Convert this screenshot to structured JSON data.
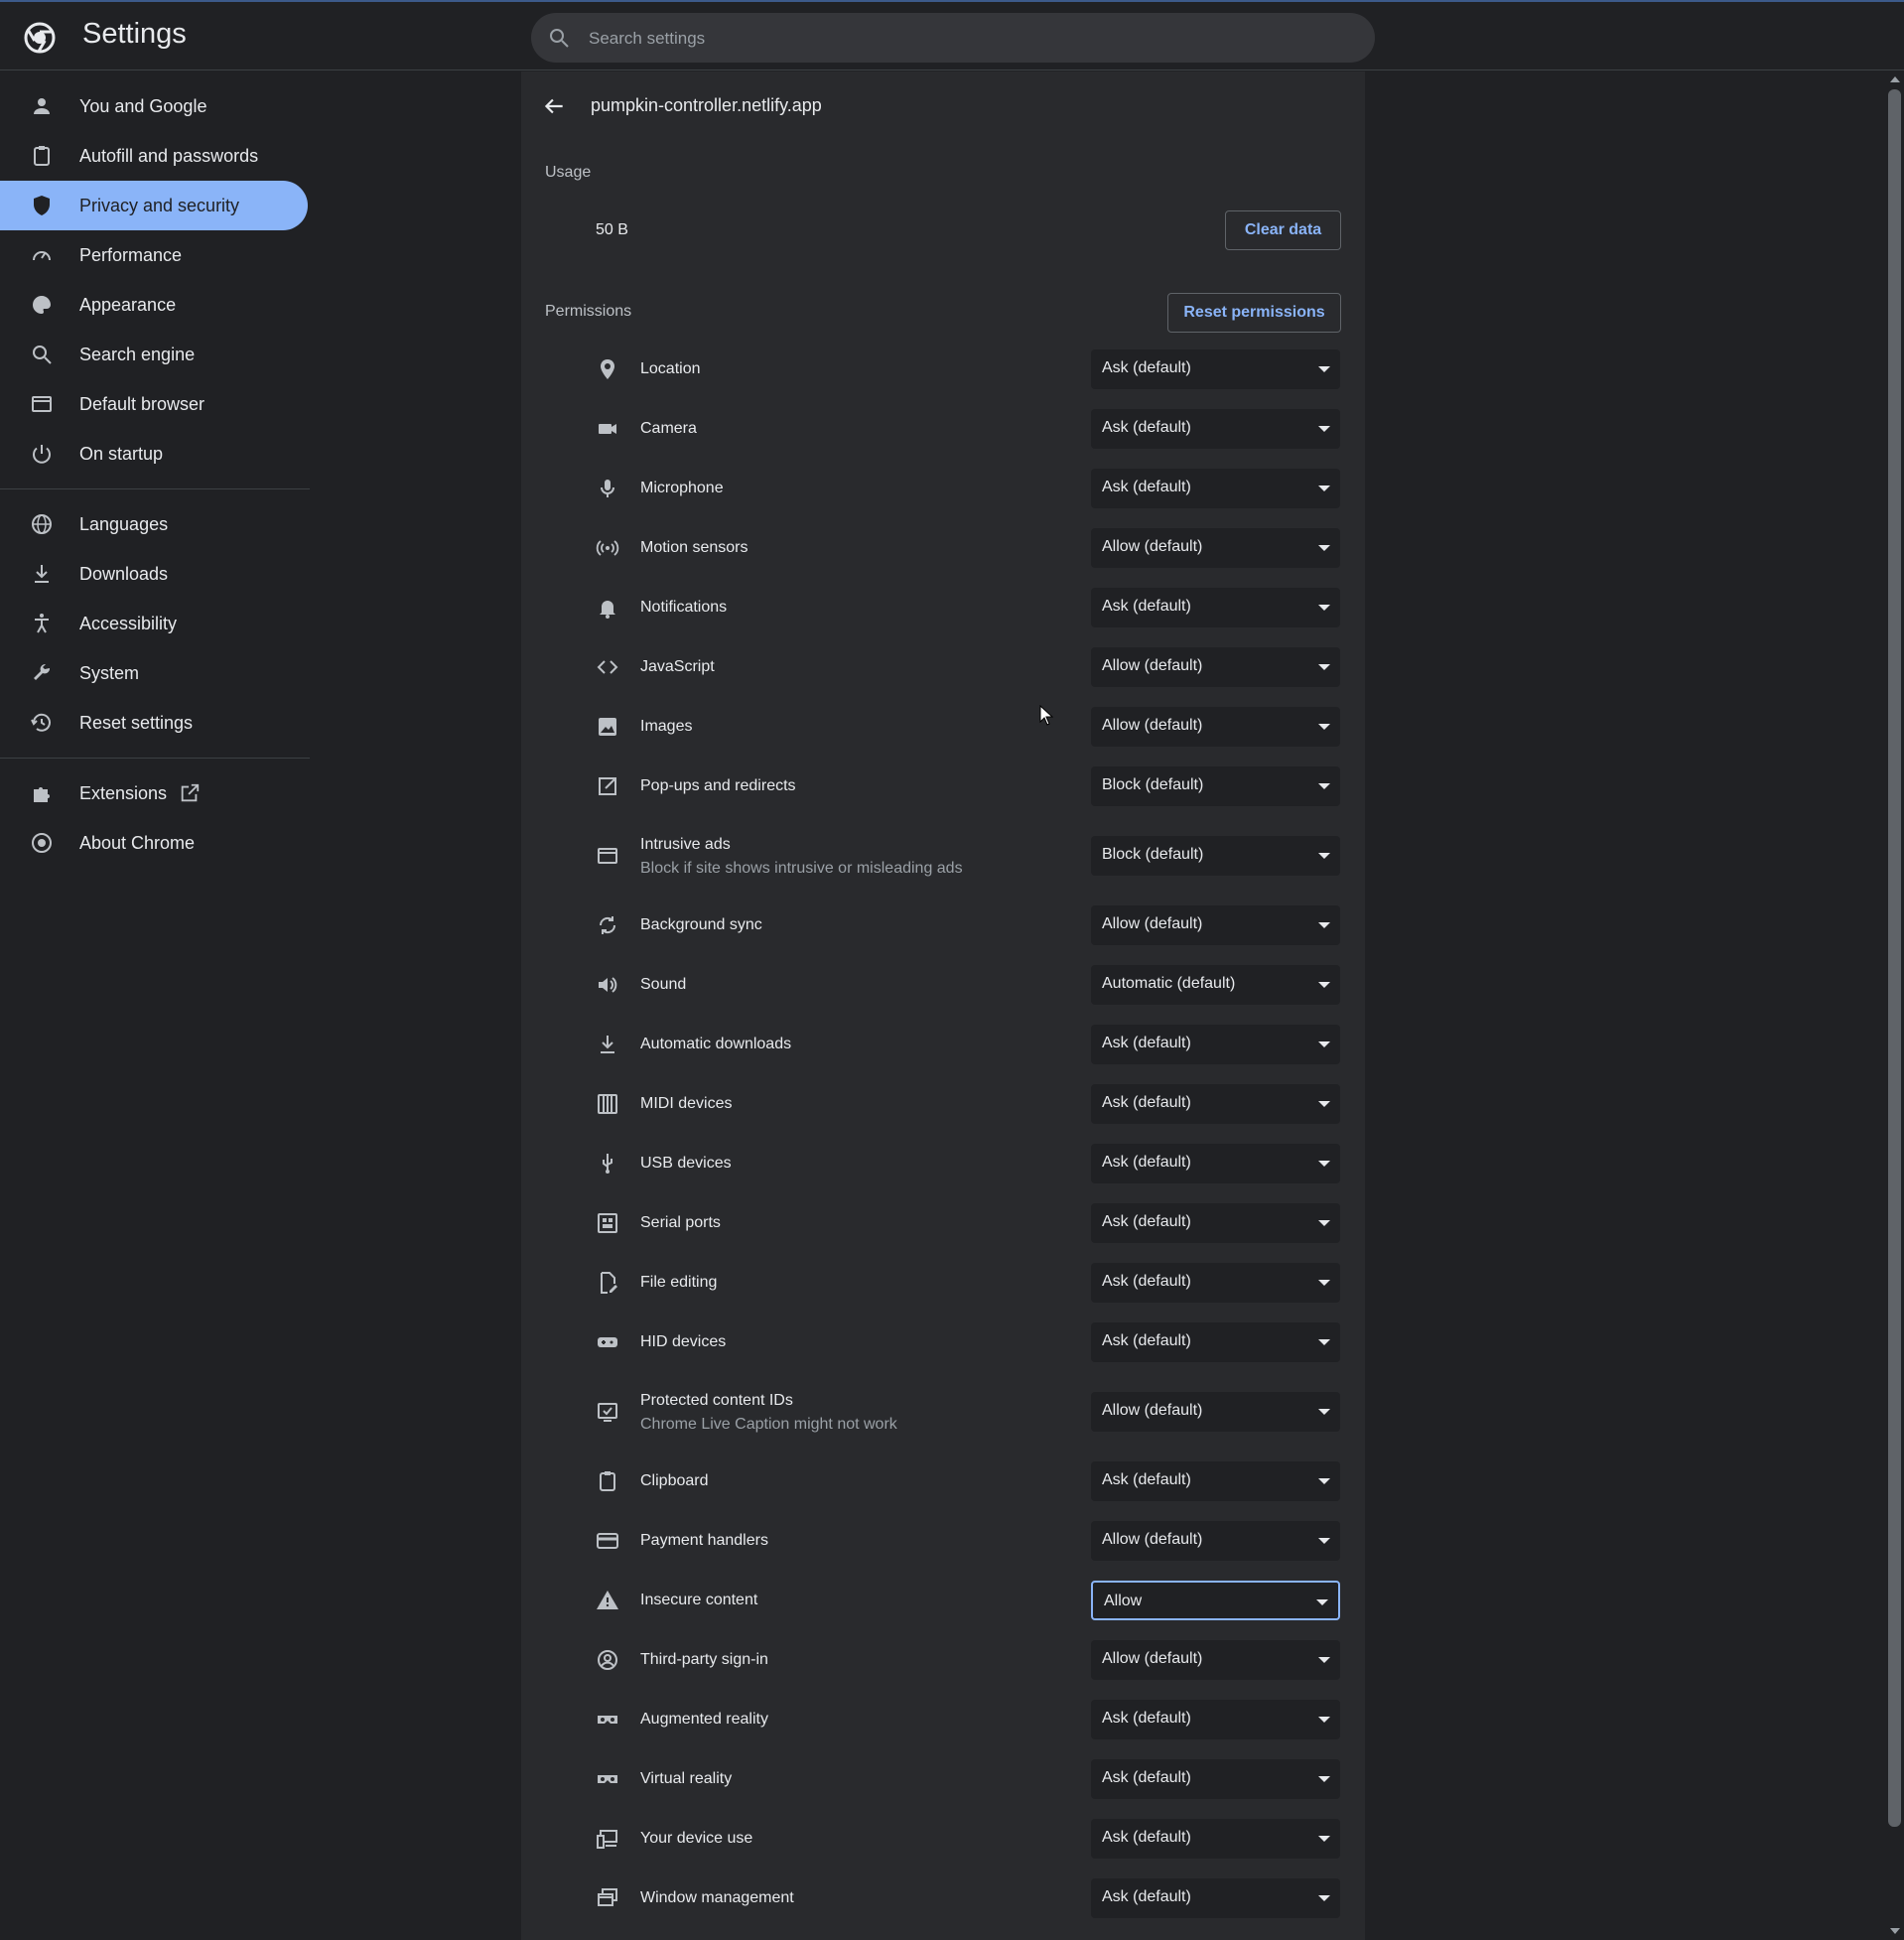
{
  "app": {
    "title": "Settings"
  },
  "search": {
    "placeholder": "Search settings"
  },
  "sidebar": {
    "groups": [
      [
        {
          "label": "You and Google",
          "icon": "person-icon"
        },
        {
          "label": "Autofill and passwords",
          "icon": "clipboard-icon"
        },
        {
          "label": "Privacy and security",
          "icon": "shield-icon",
          "active": true
        },
        {
          "label": "Performance",
          "icon": "speedometer-icon"
        },
        {
          "label": "Appearance",
          "icon": "palette-icon"
        },
        {
          "label": "Search engine",
          "icon": "search-icon"
        },
        {
          "label": "Default browser",
          "icon": "browser-icon"
        },
        {
          "label": "On startup",
          "icon": "power-icon"
        }
      ],
      [
        {
          "label": "Languages",
          "icon": "globe-icon"
        },
        {
          "label": "Downloads",
          "icon": "download-icon"
        },
        {
          "label": "Accessibility",
          "icon": "accessibility-icon"
        },
        {
          "label": "System",
          "icon": "wrench-icon"
        },
        {
          "label": "Reset settings",
          "icon": "history-icon"
        }
      ],
      [
        {
          "label": "Extensions",
          "icon": "puzzle-icon",
          "external": true
        },
        {
          "label": "About Chrome",
          "icon": "chrome-icon"
        }
      ]
    ]
  },
  "site": {
    "title": "pumpkin-controller.netlify.app",
    "usage_label": "Usage",
    "usage_value": "50 B",
    "clear_data_label": "Clear data",
    "permissions_label": "Permissions",
    "reset_permissions_label": "Reset permissions"
  },
  "permissions": [
    {
      "label": "Location",
      "icon": "location-pin-icon",
      "value": "Ask (default)"
    },
    {
      "label": "Camera",
      "icon": "camera-icon",
      "value": "Ask (default)"
    },
    {
      "label": "Microphone",
      "icon": "microphone-icon",
      "value": "Ask (default)"
    },
    {
      "label": "Motion sensors",
      "icon": "motion-sensor-icon",
      "value": "Allow (default)"
    },
    {
      "label": "Notifications",
      "icon": "bell-icon",
      "value": "Ask (default)"
    },
    {
      "label": "JavaScript",
      "icon": "code-icon",
      "value": "Allow (default)"
    },
    {
      "label": "Images",
      "icon": "image-icon",
      "value": "Allow (default)"
    },
    {
      "label": "Pop-ups and redirects",
      "icon": "external-link-icon",
      "value": "Block (default)"
    },
    {
      "label": "Intrusive ads",
      "sub": "Block if site shows intrusive or misleading ads",
      "icon": "ad-frame-icon",
      "value": "Block (default)"
    },
    {
      "label": "Background sync",
      "icon": "sync-icon",
      "value": "Allow (default)"
    },
    {
      "label": "Sound",
      "icon": "speaker-icon",
      "value": "Automatic (default)"
    },
    {
      "label": "Automatic downloads",
      "icon": "download-icon",
      "value": "Ask (default)"
    },
    {
      "label": "MIDI devices",
      "icon": "piano-icon",
      "value": "Ask (default)"
    },
    {
      "label": "USB devices",
      "icon": "usb-icon",
      "value": "Ask (default)"
    },
    {
      "label": "Serial ports",
      "icon": "serial-port-icon",
      "value": "Ask (default)"
    },
    {
      "label": "File editing",
      "icon": "file-edit-icon",
      "value": "Ask (default)"
    },
    {
      "label": "HID devices",
      "icon": "gamepad-icon",
      "value": "Ask (default)"
    },
    {
      "label": "Protected content IDs",
      "sub": "Chrome Live Caption might not work",
      "icon": "protected-content-icon",
      "value": "Allow (default)"
    },
    {
      "label": "Clipboard",
      "icon": "clipboard-icon",
      "value": "Ask (default)"
    },
    {
      "label": "Payment handlers",
      "icon": "credit-card-icon",
      "value": "Allow (default)"
    },
    {
      "label": "Insecure content",
      "icon": "warning-icon",
      "value": "Allow",
      "focused": true
    },
    {
      "label": "Third-party sign-in",
      "icon": "account-circle-icon",
      "value": "Allow (default)"
    },
    {
      "label": "Augmented reality",
      "icon": "ar-headset-icon",
      "value": "Ask (default)"
    },
    {
      "label": "Virtual reality",
      "icon": "vr-headset-icon",
      "value": "Ask (default)"
    },
    {
      "label": "Your device use",
      "icon": "devices-icon",
      "value": "Ask (default)"
    },
    {
      "label": "Window management",
      "icon": "windows-icon",
      "value": "Ask (default)"
    }
  ],
  "colors": {
    "accent": "#8ab4f8",
    "background": "#202124",
    "panel": "#292a2d",
    "text": "#e8eaed",
    "secondary_text": "#9aa0a6"
  }
}
